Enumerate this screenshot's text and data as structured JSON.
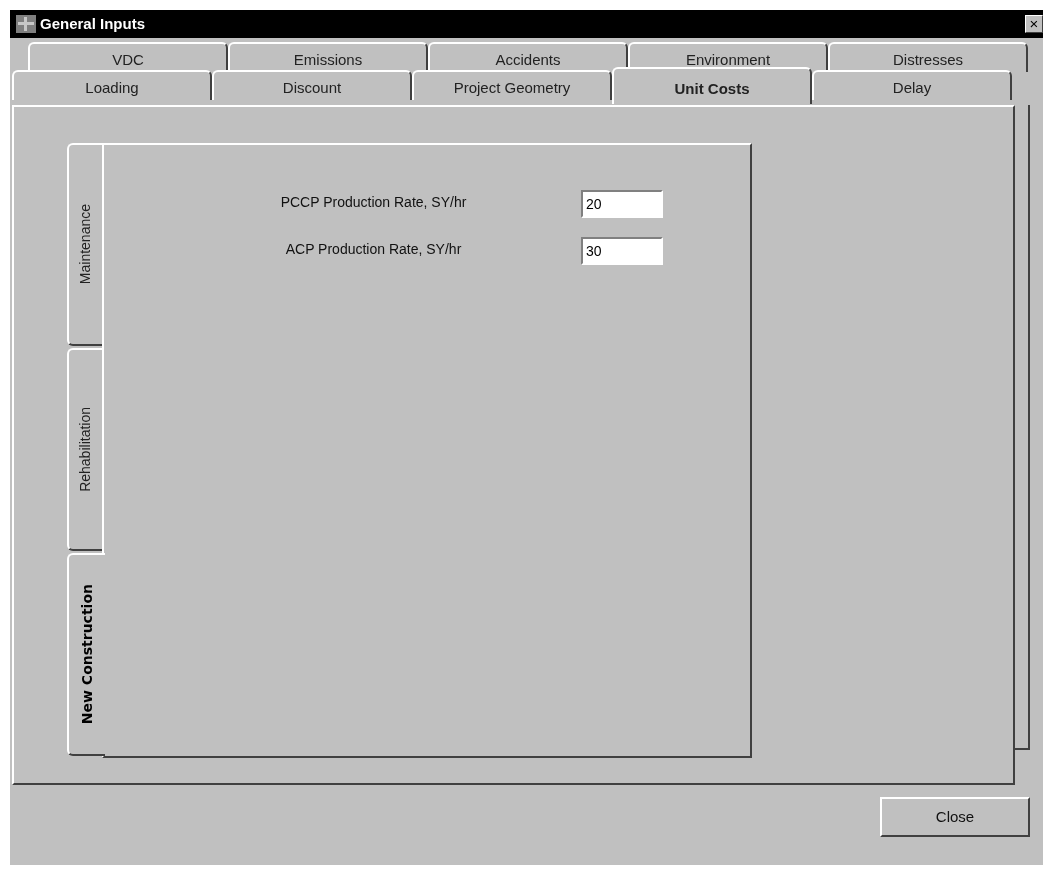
{
  "window": {
    "title": "General Inputs",
    "close": "×"
  },
  "tab_rows": [
    [
      {
        "label": "VDC",
        "selected": false
      },
      {
        "label": "Emissions",
        "selected": false
      },
      {
        "label": "Accidents",
        "selected": false
      },
      {
        "label": "Environment",
        "selected": false
      },
      {
        "label": "Distresses",
        "selected": false
      }
    ],
    [
      {
        "label": "Loading",
        "selected": false
      },
      {
        "label": "Discount",
        "selected": false
      },
      {
        "label": "Project Geometry",
        "selected": false
      },
      {
        "label": "Unit Costs",
        "selected": true
      },
      {
        "label": "Delay",
        "selected": false
      }
    ]
  ],
  "side_tabs": [
    {
      "label": "Maintenance",
      "selected": false
    },
    {
      "label": "Rehabilitation",
      "selected": false
    },
    {
      "label": "New Construction",
      "selected": true
    }
  ],
  "fields": [
    {
      "label": "PCCP Production Rate, SY/hr",
      "value": "20"
    },
    {
      "label": "ACP Production Rate, SY/hr",
      "value": "30"
    }
  ],
  "buttons": [
    "Close"
  ]
}
